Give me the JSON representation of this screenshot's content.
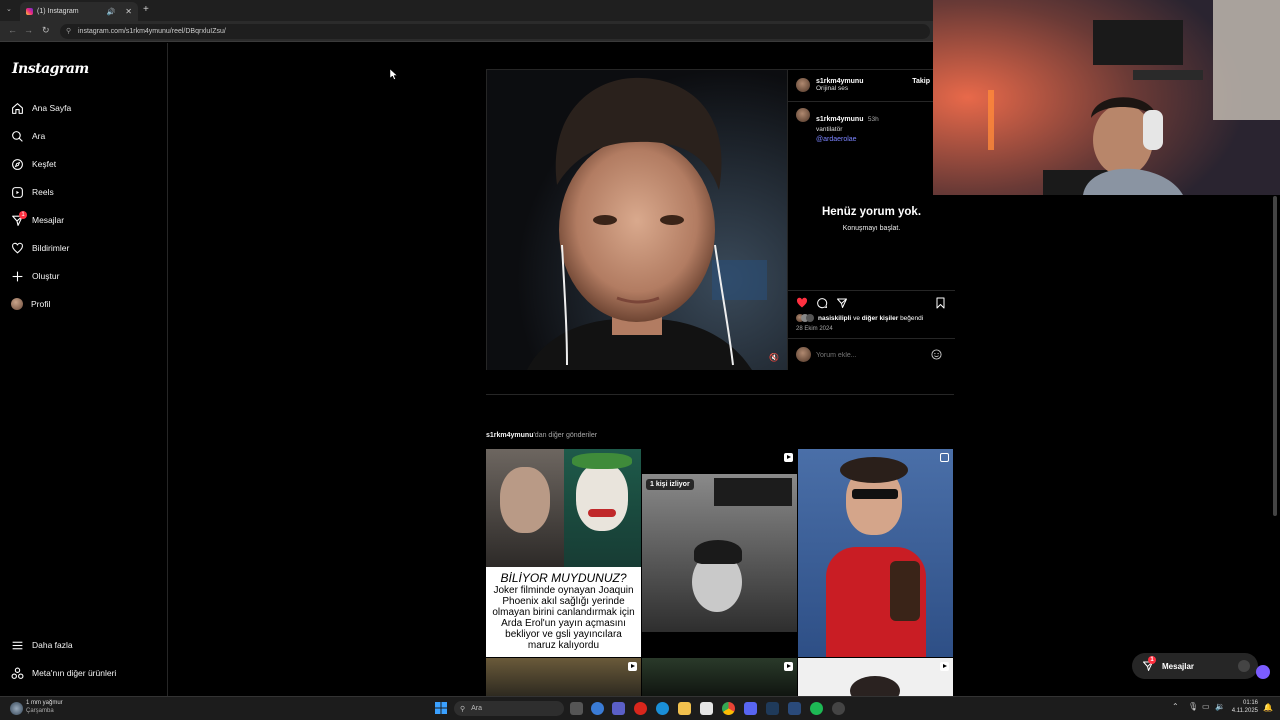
{
  "browser": {
    "tab_title": "(1) Instagram",
    "url": "instagram.com/s1rkm4ymunu/reel/DBqrxluIZsu/"
  },
  "sidebar": {
    "logo": "Instagram",
    "items": [
      {
        "label": "Ana Sayfa",
        "icon": "home-icon"
      },
      {
        "label": "Ara",
        "icon": "search-icon"
      },
      {
        "label": "Keşfet",
        "icon": "compass-icon"
      },
      {
        "label": "Reels",
        "icon": "reels-icon"
      },
      {
        "label": "Mesajlar",
        "icon": "messenger-icon",
        "badge": "1"
      },
      {
        "label": "Bildirimler",
        "icon": "heart-icon"
      },
      {
        "label": "Oluştur",
        "icon": "plus-icon"
      },
      {
        "label": "Profil",
        "icon": "avatar"
      }
    ],
    "more_label": "Daha fazla",
    "meta_label": "Meta'nın diğer ürünleri"
  },
  "post": {
    "author": "s1rkm4ymunu",
    "audio": "Orijinal ses",
    "follow_label": "Takip",
    "caption_author": "s1rkm4ymunu",
    "caption_time": "53h",
    "caption_text": "vantilatör",
    "mention": "@ardaerolae",
    "no_comments_title": "Henüz yorum yok.",
    "no_comments_sub": "Konuşmayı başlat.",
    "liked_by_user": "nasiskilipli",
    "liked_by_rest": "ve",
    "liked_by_others": "diğer kişiler",
    "liked_by_suffix": "beğendi",
    "date": "28 Ekim 2024",
    "comment_placeholder": "Yorum ekle..."
  },
  "more_posts": {
    "user": "s1rkm4ymunu",
    "suffix": "'dan diğer gönderiler",
    "thumb1_title": "BİLİYOR MUYDUNUZ?",
    "thumb1_body": "Joker filminde oynayan Joaquin Phoenix akıl sağlığı yerinde olmayan birini canlandırmak için Arda Erol'un yayın açmasını bekliyor ve gsli yayıncılara maruz kalıyordu",
    "thumb2_overlay": "1 kişi izliyor"
  },
  "messages_pill": {
    "label": "Mesajlar",
    "badge": "1"
  },
  "taskbar": {
    "weather_title": "1 mm yağmur",
    "weather_sub": "Çarşamba",
    "search_label": "Ara",
    "time": "01:16",
    "date": "4.11.2025"
  },
  "colors": {
    "accent_blue": "#4150f7",
    "like_red": "#ff3040",
    "border": "#262626"
  }
}
